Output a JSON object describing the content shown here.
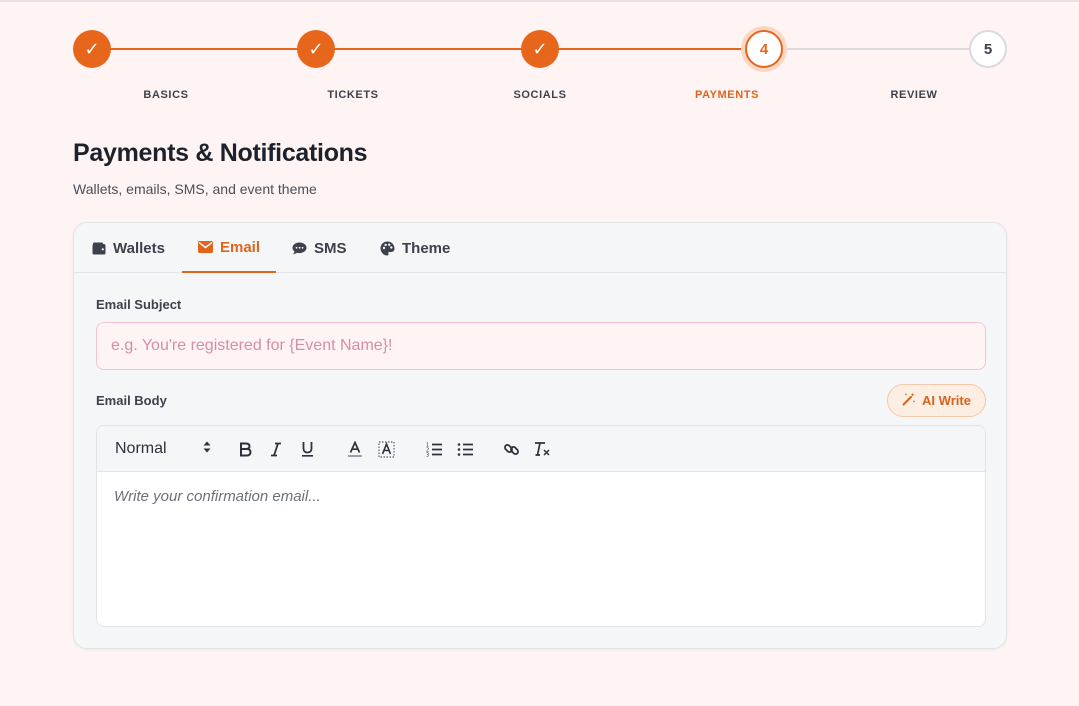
{
  "stepper": {
    "steps": [
      {
        "label": "BASICS",
        "state": "done",
        "mark": "✓"
      },
      {
        "label": "TICKETS",
        "state": "done",
        "mark": "✓"
      },
      {
        "label": "SOCIALS",
        "state": "done",
        "mark": "✓"
      },
      {
        "label": "PAYMENTS",
        "state": "current",
        "mark": "4"
      },
      {
        "label": "REVIEW",
        "state": "todo",
        "mark": "5"
      }
    ]
  },
  "header": {
    "title": "Payments & Notifications",
    "subtitle": "Wallets, emails, SMS, and event theme"
  },
  "tabs": [
    {
      "label": "Wallets",
      "icon": "wallet-icon"
    },
    {
      "label": "Email",
      "icon": "envelope-icon",
      "active": true
    },
    {
      "label": "SMS",
      "icon": "chat-icon"
    },
    {
      "label": "Theme",
      "icon": "palette-icon"
    }
  ],
  "email": {
    "subject_label": "Email Subject",
    "subject_value": "",
    "subject_placeholder": "e.g. You're registered for {Event Name}!",
    "body_label": "Email Body",
    "ai_write_label": "AI Write",
    "body_placeholder": "Write your confirmation email...",
    "format_value": "Normal"
  },
  "colors": {
    "accent": "#e8661c",
    "background": "#fff4f4",
    "card": "#f5f6f8"
  }
}
